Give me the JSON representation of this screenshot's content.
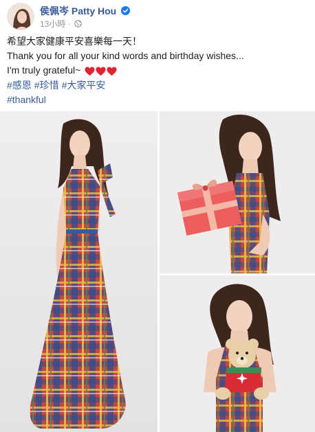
{
  "post": {
    "author": "侯佩岑 Patty Hou",
    "timestamp": "13小時",
    "separator": "·",
    "icons": {
      "verified": "verified-badge-icon",
      "privacy": "globe-icon",
      "heart": "red-heart-icon"
    },
    "text_lines": [
      "希望大家健康平安喜樂每一天！",
      "Thank you for all your kind words and birthday wishes...",
      "I'm truly grateful~"
    ],
    "hashtags_line1": [
      "#感恩",
      "#珍惜",
      "#大家平安"
    ],
    "hashtags_line2": [
      "#thankful"
    ],
    "colors": {
      "link": "#385898",
      "verified": "#1877f2",
      "meta": "#90949c",
      "heart": "#e02434"
    }
  },
  "photos": [
    {
      "name": "photo-full-length-plaid-dress"
    },
    {
      "name": "photo-holding-gift-box"
    },
    {
      "name": "photo-holding-teddy-bear"
    }
  ]
}
